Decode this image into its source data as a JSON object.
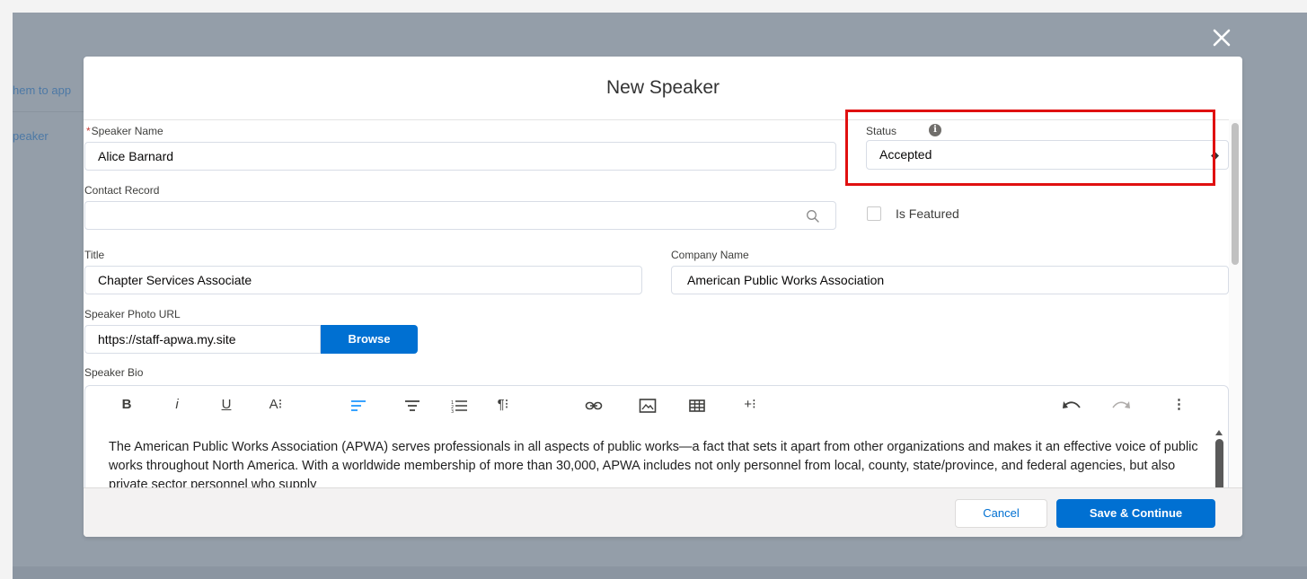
{
  "background": {
    "text_fragment_1": "hem to app",
    "text_fragment_2": "peaker"
  },
  "modal": {
    "title": "New Speaker",
    "close_icon": "close-icon"
  },
  "form": {
    "speaker_name": {
      "label": "Speaker Name",
      "required_mark": "*",
      "value": "Alice Barnard"
    },
    "status": {
      "label": "Status",
      "info_icon": "i",
      "value": "Accepted"
    },
    "contact_record": {
      "label": "Contact Record",
      "value": "",
      "icon": "search-icon"
    },
    "is_featured": {
      "label": "Is Featured",
      "checked": false
    },
    "title": {
      "label": "Title",
      "value": "Chapter Services Associate"
    },
    "company_name": {
      "label": "Company Name",
      "value": "American Public Works Association"
    },
    "speaker_photo_url": {
      "label": "Speaker Photo URL",
      "value": "https://staff-apwa.my.site",
      "browse_label": "Browse"
    },
    "speaker_bio": {
      "label": "Speaker Bio",
      "toolbar": {
        "bold": "B",
        "italic": "i",
        "underline": "U",
        "font": "A⁝",
        "paragraph": "¶⁝",
        "insert": "+⁝",
        "more": "⋮"
      },
      "text": "The American Public Works Association (APWA) serves professionals in all aspects of public works—a fact that sets it apart from other organizations and makes it an effective voice of public works throughout North America. With a worldwide membership of more than 30,000, APWA includes not only personnel from local, county, state/province, and federal agencies, but also private sector personnel who supply"
    }
  },
  "footer": {
    "cancel_label": "Cancel",
    "save_label": "Save & Continue"
  },
  "colors": {
    "brand": "#0070d2",
    "highlight": "#e01010",
    "active_tool": "#1b96ff"
  }
}
